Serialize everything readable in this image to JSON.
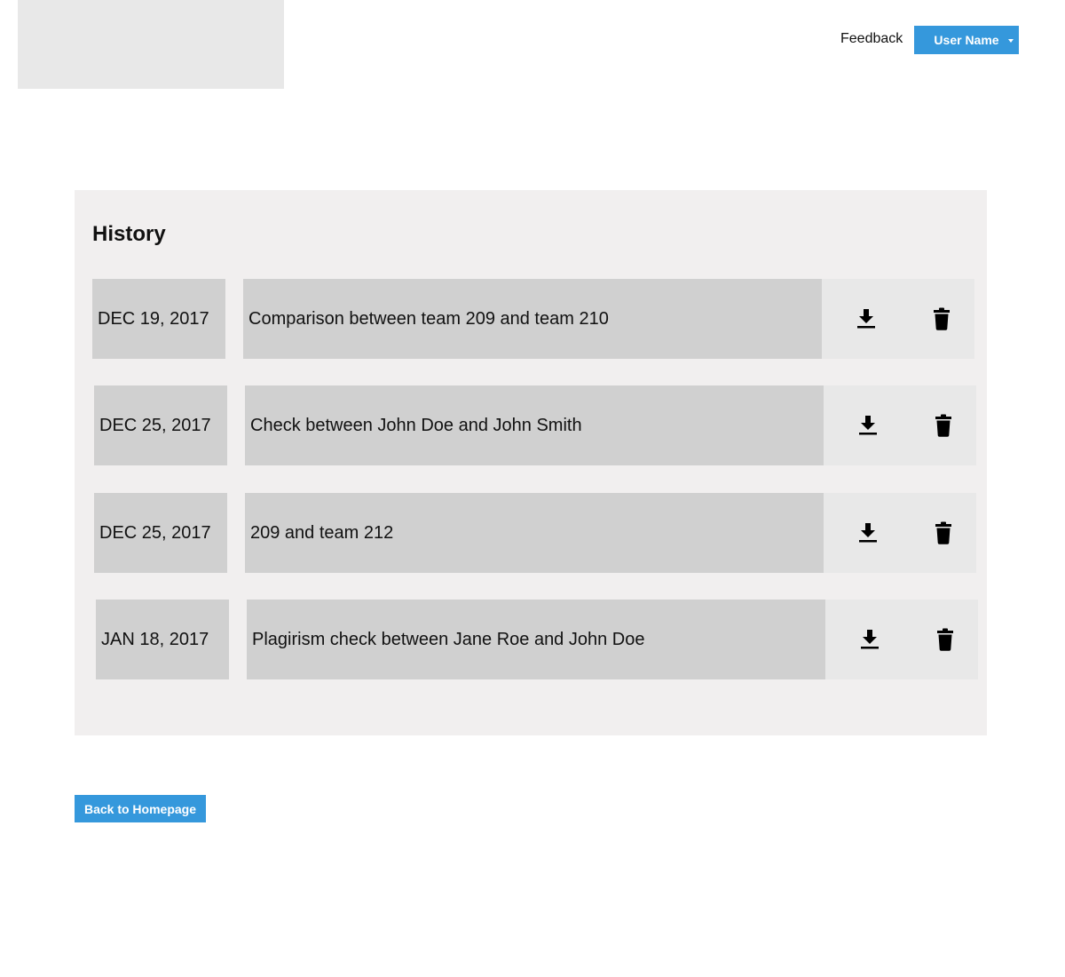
{
  "header": {
    "feedback_label": "Feedback",
    "user_menu_label": "User Name",
    "accent_color": "#3598dc"
  },
  "history": {
    "title": "History",
    "rows": [
      {
        "date": "DEC 19, 2017",
        "description": "Comparison between team 209 and team 210",
        "download_icon": "download-icon",
        "delete_icon": "trash-icon"
      },
      {
        "date": "DEC 25, 2017",
        "description": "Check between John Doe and John Smith",
        "download_icon": "download-icon",
        "delete_icon": "trash-icon"
      },
      {
        "date": "DEC 25, 2017",
        "description": "209 and team 212",
        "download_icon": "download-icon",
        "delete_icon": "trash-icon"
      },
      {
        "date": "JAN 18, 2017",
        "description": "Plagirism check between Jane Roe and John Doe",
        "download_icon": "download-icon",
        "delete_icon": "trash-icon"
      }
    ]
  },
  "footer": {
    "back_button_label": "Back to Homepage"
  }
}
